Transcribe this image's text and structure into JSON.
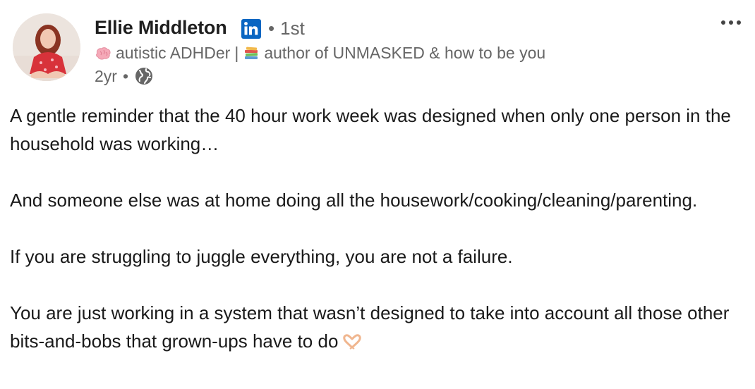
{
  "post": {
    "author": {
      "name": "Ellie Middleton",
      "degree": "1st",
      "degree_separator": "•",
      "headline_part1": "autistic ADHDer",
      "headline_separator": "|",
      "headline_part2": "author of UNMASKED & how to be you",
      "time": "2yr",
      "time_separator": "•"
    },
    "icons": {
      "linkedin_badge": "linkedin-icon",
      "brain_emoji": "brain-emoji-icon",
      "books_emoji": "books-emoji-icon",
      "visibility": "globe-icon",
      "more": "more-options-icon",
      "heart_hands": "heart-hands-emoji-icon"
    },
    "colors": {
      "linkedin_blue": "#0a66c2",
      "name_text": "#1f1f1f",
      "secondary_text": "#666666",
      "body_text": "#1a1a1a"
    },
    "paragraphs": [
      "A gentle reminder that the 40 hour work week was designed when only one person in the household was working…",
      "And someone else was at home doing all the housework/cooking/cleaning/parenting.",
      "If you are struggling to juggle everything, you are not a failure.",
      "You are just working in a system that wasn’t designed to take into account all those other bits-and-bobs that grown-ups have to do"
    ]
  }
}
